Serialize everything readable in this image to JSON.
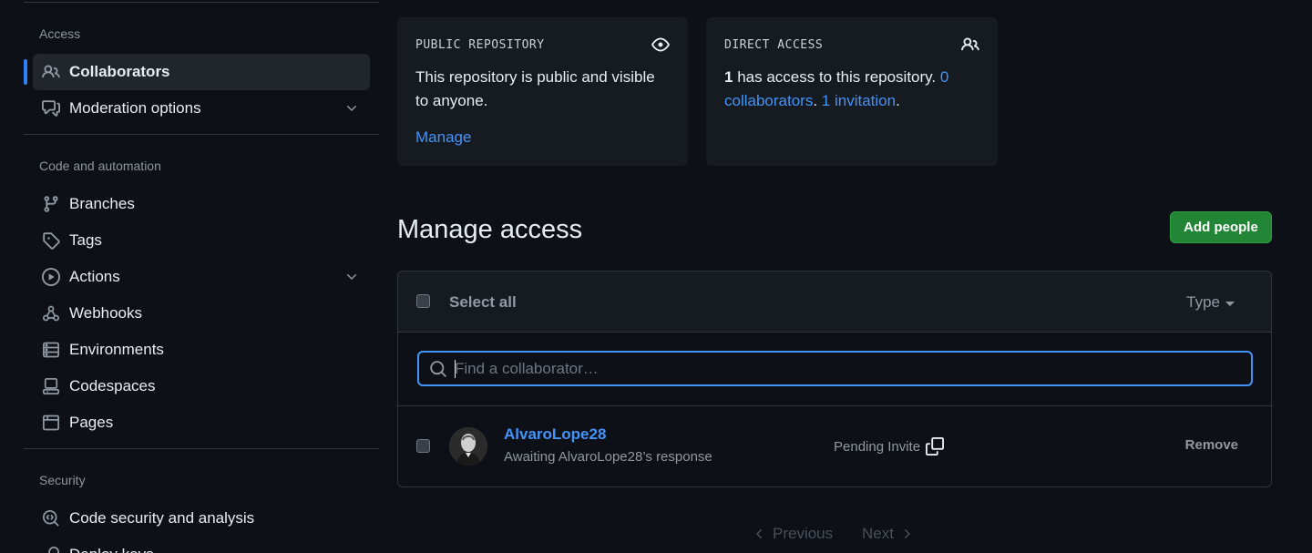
{
  "sidebar": {
    "sections": [
      {
        "heading": "Access"
      },
      {
        "heading": "Code and automation"
      },
      {
        "heading": "Security"
      }
    ],
    "items": [
      {
        "label": "Collaborators",
        "icon": "people-icon",
        "active": true
      },
      {
        "label": "Moderation options",
        "icon": "comment-discussion-icon",
        "expandable": true
      },
      {
        "label": "Branches",
        "icon": "git-branch-icon"
      },
      {
        "label": "Tags",
        "icon": "tag-icon"
      },
      {
        "label": "Actions",
        "icon": "play-icon",
        "expandable": true
      },
      {
        "label": "Webhooks",
        "icon": "webhook-icon"
      },
      {
        "label": "Environments",
        "icon": "server-icon"
      },
      {
        "label": "Codespaces",
        "icon": "codespaces-icon"
      },
      {
        "label": "Pages",
        "icon": "browser-icon"
      },
      {
        "label": "Code security and analysis",
        "icon": "codescan-icon"
      },
      {
        "label": "Deploy keys",
        "icon": "key-icon"
      }
    ]
  },
  "cards": {
    "public": {
      "label": "PUBLIC REPOSITORY",
      "icon": "eye-icon",
      "text": "This repository is public and visible to anyone.",
      "link": "Manage"
    },
    "direct": {
      "label": "DIRECT ACCESS",
      "icon": "people-icon",
      "count": "1",
      "text_mid": " has access to this repository. ",
      "collaborators_link": "0 collaborators",
      "sep": ". ",
      "invitation_link": "1 invitation",
      "end": "."
    }
  },
  "manage": {
    "title": "Manage access",
    "add_button": "Add people",
    "select_all": "Select all",
    "type_filter": "Type",
    "search_placeholder": "Find a collaborator…",
    "members": [
      {
        "name": "AlvaroLope28",
        "subtitle": "Awaiting AlvaroLope28’s response",
        "status": "Pending Invite",
        "action": "Remove"
      }
    ]
  },
  "pagination": {
    "previous": "Previous",
    "next": "Next"
  },
  "colors": {
    "accent": "#4493f8",
    "primary_button": "#238636",
    "background": "#0d1117",
    "surface": "#161b22"
  }
}
